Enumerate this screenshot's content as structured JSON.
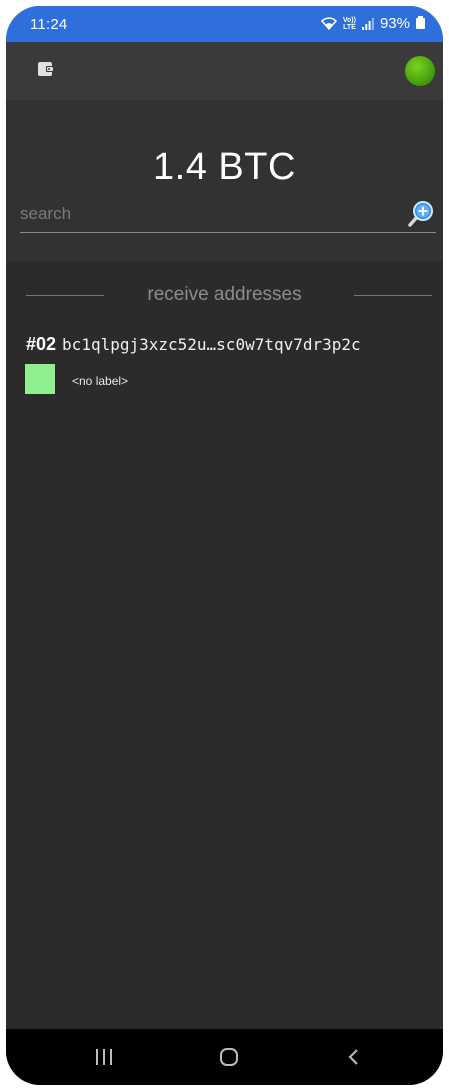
{
  "status_bar": {
    "time": "11:24",
    "lte_top": "Vo))",
    "lte_bottom": "LTE",
    "battery": "93%"
  },
  "toolbar": {
    "wallet_icon": "wallet-icon",
    "connection_status": "connected",
    "status_color": "#5cb815"
  },
  "header": {
    "balance": "1.4 BTC",
    "search_placeholder": "search",
    "search_icon": "magnifier-plus-icon"
  },
  "section": {
    "title": "receive addresses"
  },
  "addresses": [
    {
      "index": "#02",
      "address": "bc1qlpgj3xzc52u…sc0w7tqv7dr3p2c",
      "label": "<no label>",
      "label_color": "#8ff08f"
    }
  ],
  "navbar": {
    "recents_icon": "recents-icon",
    "home_icon": "home-icon",
    "back_icon": "back-icon"
  },
  "colors": {
    "status_bar_bg": "#2f6fdc",
    "toolbar_bg": "#3a3a3a",
    "header_bg": "#323232",
    "body_bg": "#2b2b2b"
  }
}
